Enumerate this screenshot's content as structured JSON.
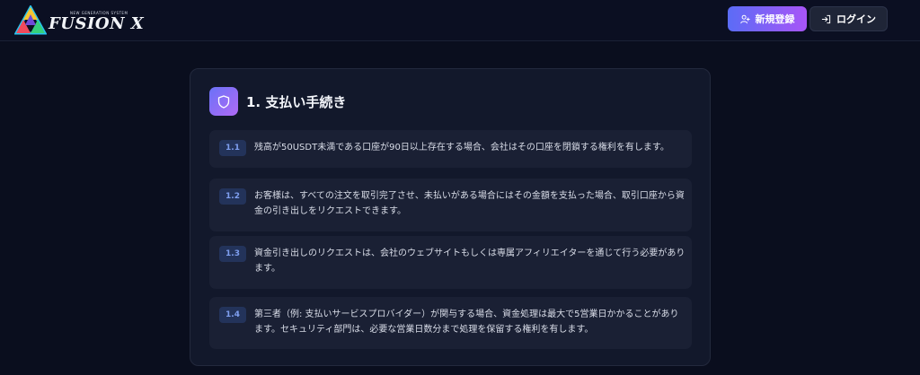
{
  "brand": {
    "name": "FUSION X",
    "tagline": "NEW GENERATION SYSTEM",
    "logo_icon": "triangle-logo-icon"
  },
  "header": {
    "register_label": "新規登録",
    "register_icon": "user-plus-icon",
    "login_label": "ログイン",
    "login_icon": "sign-in-icon"
  },
  "section": {
    "icon": "shield-icon",
    "title": "1. 支払い手続き",
    "items": [
      {
        "number": "1.1",
        "text": "残高が50USDT未満である口座が90日以上存在する場合、会社はその口座を閉鎖する権利を有します。"
      },
      {
        "number": "1.2",
        "text": "お客様は、すべての注文を取引完了させ、未払いがある場合にはその金額を支払った場合、取引口座から資金の引き出しをリクエストできます。"
      },
      {
        "number": "1.3",
        "text": "資金引き出しのリクエストは、会社のウェブサイトもしくは専属アフィリエイターを通じて行う必要があります。"
      },
      {
        "number": "1.4",
        "text": "第三者（例: 支払いサービスプロバイダー）が関与する場合、資金処理は最大で5営業日かかることがあります。セキュリティ部門は、必要な営業日数分まで処理を保留する権利を有します。"
      }
    ]
  },
  "colors": {
    "background": "#0a0e1e",
    "card": "#12182b",
    "item": "#1a2034",
    "accent_start": "#5b6cf6",
    "accent_end": "#a855f7",
    "number_badge_text": "#7f9ff0"
  }
}
